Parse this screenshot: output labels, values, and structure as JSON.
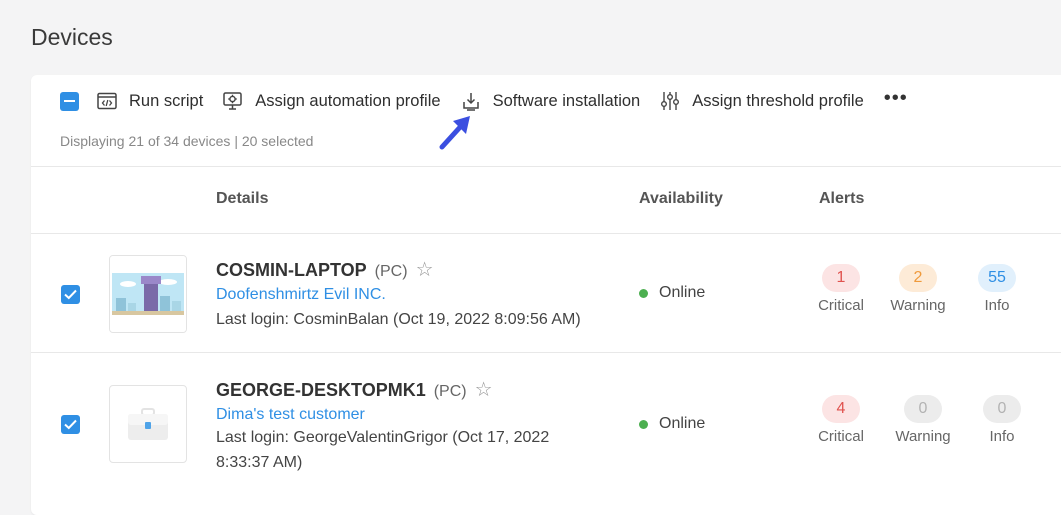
{
  "page": {
    "title": "Devices"
  },
  "toolbar": {
    "run_script": "Run script",
    "assign_automation": "Assign automation profile",
    "software_installation": "Software installation",
    "assign_threshold": "Assign threshold profile",
    "more": "•••"
  },
  "selection_text": "Displaying 21 of 34 devices | 20 selected",
  "columns": {
    "details": "Details",
    "availability": "Availability",
    "alerts": "Alerts"
  },
  "devices": [
    {
      "name": "COSMIN-LAPTOP",
      "type": "(PC)",
      "customer": "Doofenshmirtz Evil INC.",
      "last_login": "Last login: CosminBalan (Oct 19, 2022 8:09:56 AM)",
      "status": "Online",
      "selected": true,
      "alerts": {
        "critical": "1",
        "warning": "2",
        "info": "55"
      }
    },
    {
      "name": "GEORGE-DESKTOPMK1",
      "type": "(PC)",
      "customer": "Dima's test customer",
      "last_login": "Last login: GeorgeValentinGrigor (Oct 17, 2022 8:33:37 AM)",
      "status": "Online",
      "selected": true,
      "alerts": {
        "critical": "4",
        "warning": "0",
        "info": "0"
      }
    }
  ],
  "alert_labels": {
    "critical": "Critical",
    "warning": "Warning",
    "info": "Info"
  },
  "colors": {
    "accent": "#2f8fe4",
    "online": "#4caf50",
    "critical": "#e0534f",
    "warning": "#ef9a3c",
    "annotation_arrow": "#3b4fe0"
  },
  "icons": {
    "run_script": "code-window-icon",
    "assign_automation": "monitor-gear-icon",
    "software_installation": "download-tray-icon",
    "assign_threshold": "sliders-icon",
    "favorite": "star-outline-icon"
  }
}
